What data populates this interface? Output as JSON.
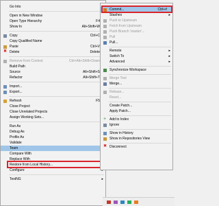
{
  "main_menu": {
    "items": [
      {
        "label": "Go Into",
        "accel": "",
        "submenu": false,
        "disabled": false,
        "icon": "",
        "color": ""
      },
      {
        "sep": true
      },
      {
        "label": "Open in New Window",
        "accel": "",
        "submenu": false,
        "disabled": false,
        "icon": "",
        "color": ""
      },
      {
        "label": "Open Type Hierarchy",
        "accel": "F4",
        "submenu": false,
        "disabled": false,
        "icon": "",
        "color": ""
      },
      {
        "label": "Show In",
        "accel": "Alt+Shift+W",
        "submenu": true,
        "disabled": false,
        "icon": "",
        "color": ""
      },
      {
        "sep": true
      },
      {
        "label": "Copy",
        "accel": "Ctrl+C",
        "submenu": false,
        "disabled": false,
        "icon": "copy-icon",
        "color": "#7a8aa0"
      },
      {
        "label": "Copy Qualified Name",
        "accel": "",
        "submenu": false,
        "disabled": false,
        "icon": "",
        "color": ""
      },
      {
        "label": "Paste",
        "accel": "Ctrl+V",
        "submenu": false,
        "disabled": false,
        "icon": "paste-icon",
        "color": "#c99a3c"
      },
      {
        "label": "Delete",
        "accel": "Delete",
        "submenu": false,
        "disabled": false,
        "icon": "delete-icon",
        "color": "#d52020"
      },
      {
        "sep": true
      },
      {
        "label": "Remove from Context",
        "accel": "Ctrl+Alt+Shift+Down",
        "submenu": false,
        "disabled": true,
        "icon": "remove-context-icon",
        "color": "#b0b0b0"
      },
      {
        "label": "Build Path",
        "accel": "",
        "submenu": true,
        "disabled": false,
        "icon": "",
        "color": ""
      },
      {
        "label": "Source",
        "accel": "Alt+Shift+S",
        "submenu": true,
        "disabled": false,
        "icon": "",
        "color": ""
      },
      {
        "label": "Refactor",
        "accel": "Alt+Shift+T",
        "submenu": true,
        "disabled": false,
        "icon": "",
        "color": ""
      },
      {
        "sep": true
      },
      {
        "label": "Import...",
        "accel": "",
        "submenu": false,
        "disabled": false,
        "icon": "import-icon",
        "color": "#6b8fb8"
      },
      {
        "label": "Export...",
        "accel": "",
        "submenu": false,
        "disabled": false,
        "icon": "export-icon",
        "color": "#6b8fb8"
      },
      {
        "sep": true
      },
      {
        "label": "Refresh",
        "accel": "F5",
        "submenu": false,
        "disabled": false,
        "icon": "refresh-icon",
        "color": "#d9a032"
      },
      {
        "label": "Close Project",
        "accel": "",
        "submenu": false,
        "disabled": false,
        "icon": "",
        "color": ""
      },
      {
        "label": "Close Unrelated Projects",
        "accel": "",
        "submenu": false,
        "disabled": false,
        "icon": "",
        "color": ""
      },
      {
        "label": "Assign Working Sets...",
        "accel": "",
        "submenu": false,
        "disabled": false,
        "icon": "",
        "color": ""
      },
      {
        "sep": true
      },
      {
        "label": "Run As",
        "accel": "",
        "submenu": true,
        "disabled": false,
        "icon": "",
        "color": ""
      },
      {
        "label": "Debug As",
        "accel": "",
        "submenu": true,
        "disabled": false,
        "icon": "",
        "color": ""
      },
      {
        "label": "Profile As",
        "accel": "",
        "submenu": true,
        "disabled": false,
        "icon": "",
        "color": ""
      },
      {
        "label": "Validate",
        "accel": "",
        "submenu": false,
        "disabled": false,
        "icon": "",
        "color": ""
      },
      {
        "label": "Team",
        "accel": "",
        "submenu": true,
        "disabled": false,
        "icon": "",
        "color": "",
        "highlighted": true
      },
      {
        "label": "Compare With",
        "accel": "",
        "submenu": true,
        "disabled": false,
        "icon": "",
        "color": ""
      },
      {
        "label": "Replace With",
        "accel": "",
        "submenu": true,
        "disabled": false,
        "icon": "",
        "color": ""
      },
      {
        "label": "Restore from Local History...",
        "accel": "",
        "submenu": false,
        "disabled": false,
        "icon": "",
        "color": ""
      },
      {
        "label": "Configure",
        "accel": "",
        "submenu": true,
        "disabled": false,
        "icon": "",
        "color": ""
      },
      {
        "sep": true
      },
      {
        "label": "TestNG",
        "accel": "",
        "submenu": true,
        "disabled": false,
        "icon": "",
        "color": ""
      }
    ]
  },
  "team_menu": {
    "items": [
      {
        "label": "Commit...",
        "accel": "Ctrl+#",
        "submenu": false,
        "disabled": false,
        "icon": "commit-icon",
        "color": "#d27a1f",
        "highlighted": true
      },
      {
        "label": "Stashes",
        "accel": "",
        "submenu": true,
        "disabled": false,
        "icon": "",
        "color": ""
      },
      {
        "label": "Push to Upstream",
        "accel": "",
        "submenu": false,
        "disabled": true,
        "icon": "push-upstream-icon",
        "color": "#b0b0b0"
      },
      {
        "label": "Fetch from Upstream",
        "accel": "",
        "submenu": false,
        "disabled": true,
        "icon": "fetch-upstream-icon",
        "color": "#b0b0b0"
      },
      {
        "label": "Push Branch 'master'...",
        "accel": "",
        "submenu": false,
        "disabled": true,
        "icon": "push-branch-icon",
        "color": "#b0b0b0"
      },
      {
        "label": "Pull",
        "accel": "",
        "submenu": false,
        "disabled": true,
        "icon": "pull-icon",
        "color": "#b0b0b0"
      },
      {
        "label": "Pull...",
        "accel": "",
        "submenu": false,
        "disabled": false,
        "icon": "pull-dialog-icon",
        "color": "#5a7fb0"
      },
      {
        "sep": true
      },
      {
        "label": "Remote",
        "accel": "",
        "submenu": true,
        "disabled": false,
        "icon": "",
        "color": ""
      },
      {
        "label": "Switch To",
        "accel": "",
        "submenu": true,
        "disabled": false,
        "icon": "",
        "color": ""
      },
      {
        "label": "Advanced",
        "accel": "",
        "submenu": true,
        "disabled": false,
        "icon": "",
        "color": ""
      },
      {
        "sep": true
      },
      {
        "label": "Synchronize Workspace",
        "accel": "",
        "submenu": false,
        "disabled": false,
        "icon": "synchronize-icon",
        "color": "#4a8a4a"
      },
      {
        "sep": true
      },
      {
        "label": "Merge Tool",
        "accel": "",
        "submenu": false,
        "disabled": true,
        "icon": "merge-tool-icon",
        "color": "#b0b0b0"
      },
      {
        "label": "Merge...",
        "accel": "",
        "submenu": false,
        "disabled": false,
        "icon": "merge-icon",
        "color": "#6b7fa0"
      },
      {
        "sep": true
      },
      {
        "label": "Rebase...",
        "accel": "",
        "submenu": false,
        "disabled": true,
        "icon": "rebase-icon",
        "color": "#b0b0b0"
      },
      {
        "label": "Reset...",
        "accel": "",
        "submenu": false,
        "disabled": true,
        "icon": "",
        "color": ""
      },
      {
        "sep": true
      },
      {
        "label": "Create Patch...",
        "accel": "",
        "submenu": false,
        "disabled": false,
        "icon": "",
        "color": ""
      },
      {
        "label": "Apply Patch...",
        "accel": "",
        "submenu": false,
        "disabled": false,
        "icon": "",
        "color": ""
      },
      {
        "sep": true
      },
      {
        "label": "Add to Index",
        "accel": "",
        "submenu": false,
        "disabled": false,
        "icon": "add-to-index-icon",
        "color": "#3a9a3a"
      },
      {
        "label": "Ignore",
        "accel": "",
        "submenu": false,
        "disabled": false,
        "icon": "ignore-icon",
        "color": "#7a8aa0"
      },
      {
        "sep": true
      },
      {
        "label": "Show in History",
        "accel": "",
        "submenu": false,
        "disabled": false,
        "icon": "history-icon",
        "color": "#6b8fb8"
      },
      {
        "label": "Show in Repositories View",
        "accel": "",
        "submenu": false,
        "disabled": false,
        "icon": "repositories-icon",
        "color": "#c99a3c"
      },
      {
        "sep": true
      },
      {
        "label": "Disconnect",
        "accel": "",
        "submenu": false,
        "disabled": false,
        "icon": "disconnect-icon",
        "color": "#d52020"
      }
    ]
  },
  "colors": {
    "highlight": "#9fc6e8",
    "annotation_red": "#d9242b"
  }
}
